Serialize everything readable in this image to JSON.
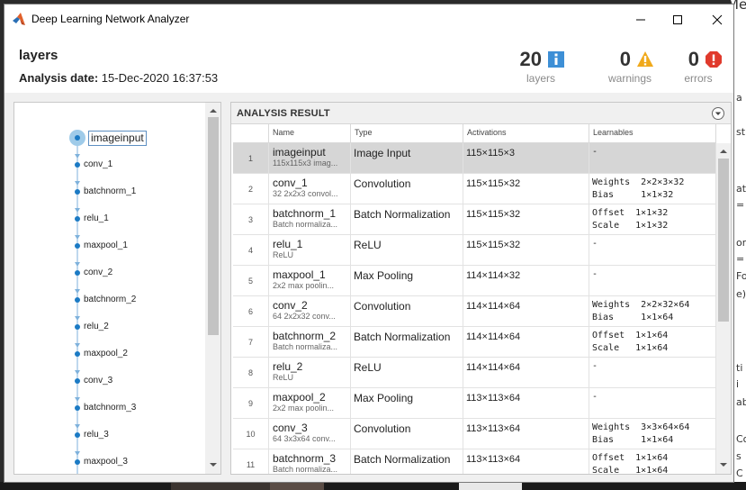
{
  "window": {
    "title": "Deep Learning Network Analyzer"
  },
  "header": {
    "network_name": "layers",
    "date_label": "Analysis date:",
    "date_value": "15-Dec-2020 16:37:53",
    "stats": [
      {
        "count": "20",
        "label": "layers",
        "icon": "info-icon",
        "color": "#3d8fd6"
      },
      {
        "count": "0",
        "label": "warnings",
        "icon": "warning-icon",
        "color": "#f0a91b"
      },
      {
        "count": "0",
        "label": "errors",
        "icon": "error-icon",
        "color": "#e03a2c"
      }
    ]
  },
  "graph": {
    "nodes": [
      "imageinput",
      "conv_1",
      "batchnorm_1",
      "relu_1",
      "maxpool_1",
      "conv_2",
      "batchnorm_2",
      "relu_2",
      "maxpool_2",
      "conv_3",
      "batchnorm_3",
      "relu_3",
      "maxpool_3"
    ],
    "selected_index": 0,
    "accent": "#1b7ac4"
  },
  "result": {
    "title": "ANALYSIS RESULT",
    "columns": [
      "Name",
      "Type",
      "Activations",
      "Learnables"
    ],
    "rows": [
      {
        "idx": "1",
        "name": "imageinput",
        "desc": "115x115x3 imag...",
        "type": "Image Input",
        "act": "115×115×3",
        "learn": "-"
      },
      {
        "idx": "2",
        "name": "conv_1",
        "desc": "32 2x2x3 convol...",
        "type": "Convolution",
        "act": "115×115×32",
        "learn": "Weights  2×2×3×32\nBias     1×1×32"
      },
      {
        "idx": "3",
        "name": "batchnorm_1",
        "desc": "Batch normaliza...",
        "type": "Batch Normalization",
        "act": "115×115×32",
        "learn": "Offset  1×1×32\nScale   1×1×32"
      },
      {
        "idx": "4",
        "name": "relu_1",
        "desc": "ReLU",
        "type": "ReLU",
        "act": "115×115×32",
        "learn": "-"
      },
      {
        "idx": "5",
        "name": "maxpool_1",
        "desc": "2x2 max poolin...",
        "type": "Max Pooling",
        "act": "114×114×32",
        "learn": "-"
      },
      {
        "idx": "6",
        "name": "conv_2",
        "desc": "64 2x2x32 conv...",
        "type": "Convolution",
        "act": "114×114×64",
        "learn": "Weights  2×2×32×64\nBias     1×1×64"
      },
      {
        "idx": "7",
        "name": "batchnorm_2",
        "desc": "Batch normaliza...",
        "type": "Batch Normalization",
        "act": "114×114×64",
        "learn": "Offset  1×1×64\nScale   1×1×64"
      },
      {
        "idx": "8",
        "name": "relu_2",
        "desc": "ReLU",
        "type": "ReLU",
        "act": "114×114×64",
        "learn": "-"
      },
      {
        "idx": "9",
        "name": "maxpool_2",
        "desc": "2x2 max poolin...",
        "type": "Max Pooling",
        "act": "113×113×64",
        "learn": "-"
      },
      {
        "idx": "10",
        "name": "conv_3",
        "desc": "64 3x3x64 conv...",
        "type": "Convolution",
        "act": "113×113×64",
        "learn": "Weights  3×3×64×64\nBias     1×1×64"
      },
      {
        "idx": "11",
        "name": "batchnorm_3",
        "desc": "Batch normaliza...",
        "type": "Batch Normalization",
        "act": "113×113×64",
        "learn": "Offset  1×1×64\nScale   1×1×64"
      }
    ]
  },
  "background": {
    "fragments": [
      "Meeting",
      "a",
      "st",
      "at",
      "=",
      "or",
      "=",
      "Fo",
      "e)",
      "ti",
      "i",
      "ab",
      "Co",
      "s",
      "C"
    ]
  }
}
